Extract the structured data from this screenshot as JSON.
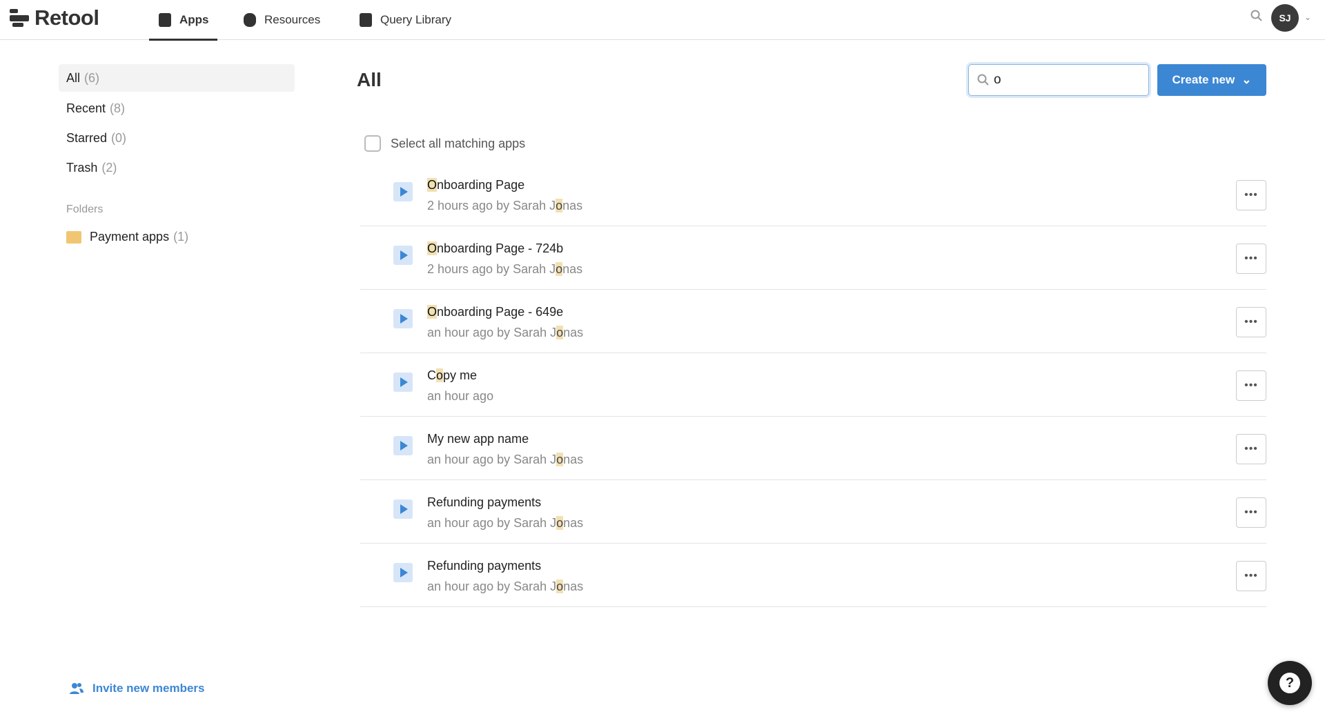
{
  "header": {
    "logo": "Retool",
    "tabs": [
      {
        "label": "Apps",
        "icon": "apps-icon",
        "active": true
      },
      {
        "label": "Resources",
        "icon": "database-icon"
      },
      {
        "label": "Query Library",
        "icon": "book-icon"
      }
    ],
    "avatar": "SJ"
  },
  "sidebar": {
    "items": [
      {
        "label": "All",
        "count": "(6)",
        "active": true
      },
      {
        "label": "Recent",
        "count": "(8)"
      },
      {
        "label": "Starred",
        "count": "(0)"
      },
      {
        "label": "Trash",
        "count": "(2)"
      }
    ],
    "folders_label": "Folders",
    "folders": [
      {
        "label": "Payment apps",
        "count": "(1)"
      }
    ],
    "invite": "Invite new members"
  },
  "main": {
    "title": "All",
    "search_value": "o",
    "create_label": "Create new",
    "select_all": "Select all matching apps",
    "apps": [
      {
        "title": [
          "",
          "O",
          "nboarding Page"
        ],
        "meta": [
          "2 hours ago by Sarah J",
          "o",
          "nas"
        ]
      },
      {
        "title": [
          "",
          "O",
          "nboarding Page - 724b"
        ],
        "meta": [
          "2 hours ago by Sarah J",
          "o",
          "nas"
        ]
      },
      {
        "title": [
          "",
          "O",
          "nboarding Page - 649e"
        ],
        "meta": [
          "an hour ago by Sarah J",
          "o",
          "nas"
        ]
      },
      {
        "title": [
          "C",
          "o",
          "py me"
        ],
        "meta": [
          "an hour ago",
          "",
          ""
        ]
      },
      {
        "title": [
          "My new app name",
          "",
          ""
        ],
        "meta": [
          "an hour ago by Sarah J",
          "o",
          "nas"
        ]
      },
      {
        "title": [
          "Refunding payments",
          "",
          ""
        ],
        "meta": [
          "an hour ago by Sarah J",
          "o",
          "nas"
        ]
      },
      {
        "title": [
          "Refunding payments",
          "",
          ""
        ],
        "meta": [
          "an hour ago by Sarah J",
          "o",
          "nas"
        ]
      }
    ],
    "more_label": "•••"
  },
  "help": "?",
  "colors": {
    "accent": "#3c87d4",
    "highlight": "#f2e0b3"
  }
}
